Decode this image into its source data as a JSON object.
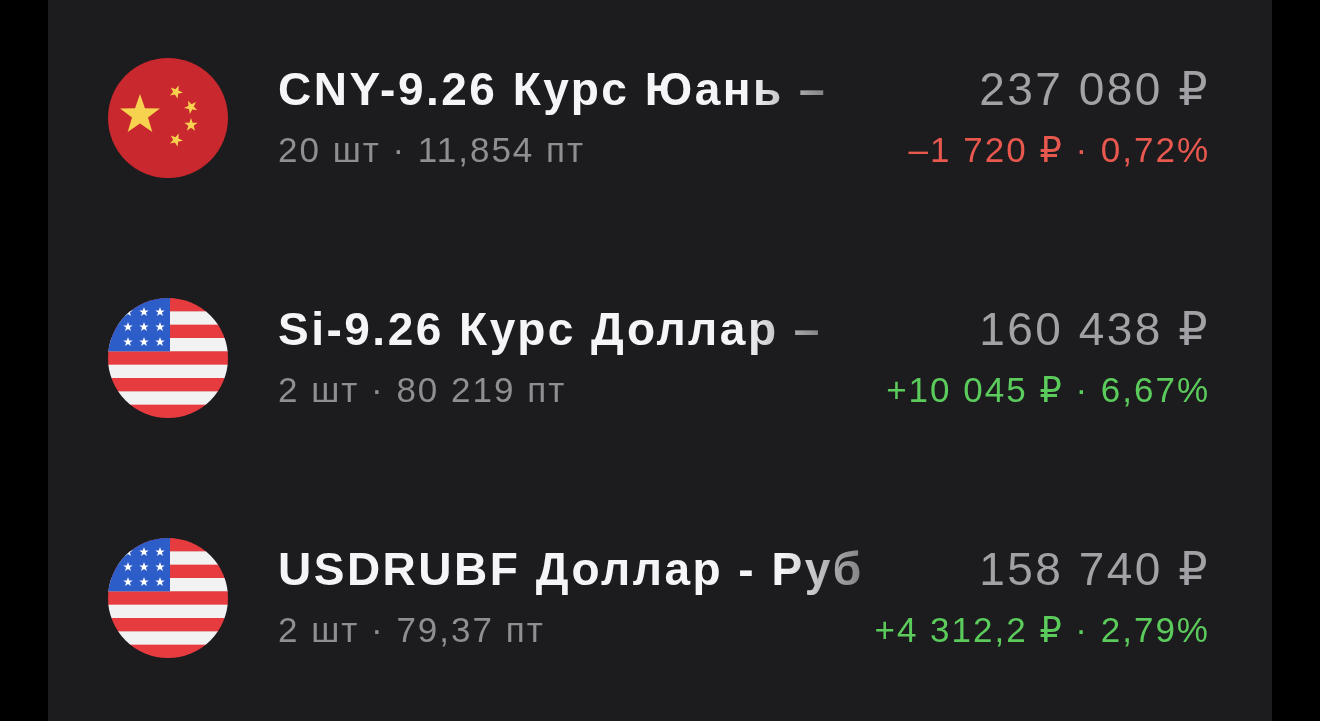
{
  "positions": [
    {
      "kind": "yuan",
      "title": "CNY-9.26 Курс Юань –",
      "details": "20 шт · 11,854 пт",
      "value": "237 080 ₽",
      "change": "–1 720 ₽ · 0,72%",
      "color": "#e8584f"
    },
    {
      "kind": "dollar",
      "title": "Si-9.26 Курс Доллар –",
      "details": "2 шт · 80 219 пт",
      "value": "160 438 ₽",
      "change": "+10 045 ₽ · 6,67%",
      "color": "#5bcb5c"
    },
    {
      "kind": "dollar",
      "title": "USDRUBF Доллар - Руб",
      "details": "2 шт · 79,37 пт",
      "value": "158 740 ₽",
      "change": "+4 312,2 ₽ · 2,79%",
      "color": "#5bcb5c"
    }
  ]
}
